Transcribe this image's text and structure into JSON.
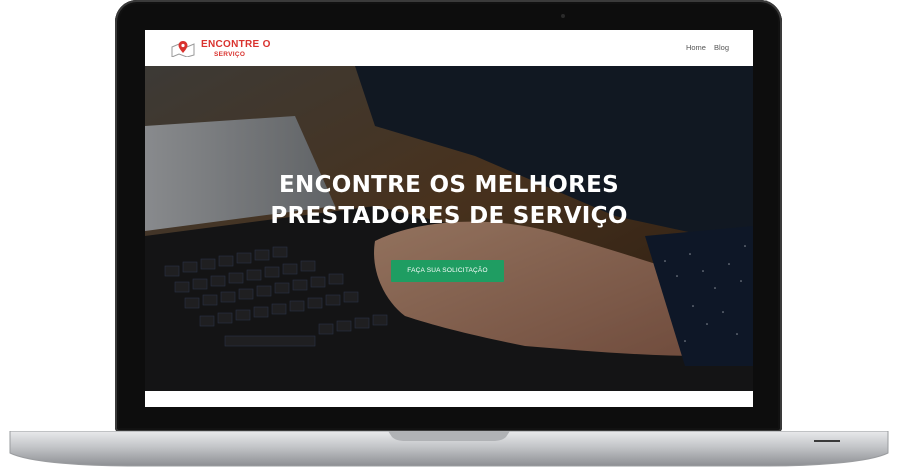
{
  "site": {
    "logo": {
      "title": "ENCONTRE O",
      "subtitle": "SERVIÇO",
      "icon": "map-pin-icon"
    },
    "nav": {
      "items": [
        {
          "label": "Home"
        },
        {
          "label": "Blog"
        }
      ]
    },
    "hero": {
      "title_line1": "ENCONTRE OS MELHORES",
      "title_line2": "PRESTADORES DE SERVIÇO",
      "cta_label": "FAÇA SUA SOLICITAÇÃO"
    }
  },
  "colors": {
    "brand_red": "#d9322e",
    "cta_green": "#1f9d62"
  }
}
